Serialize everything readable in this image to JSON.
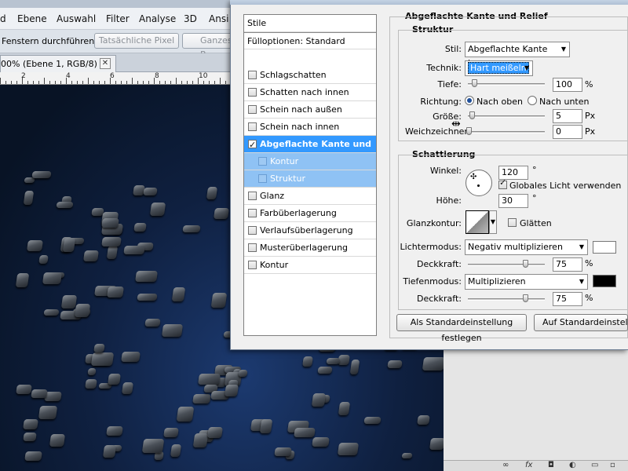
{
  "photoshop": {
    "menu": [
      "d",
      "Ebene",
      "Auswahl",
      "Filter",
      "Analyse",
      "3D",
      "Ansi"
    ],
    "options": {
      "run_in_windows_label": "Fenstern durchführen",
      "actual_pixels_label": "Tatsächliche Pixel",
      "whole_image_label": "Ganzes B"
    },
    "doc_tab": {
      "label": "00% (Ebene 1, RGB/8) *",
      "close": "✕"
    },
    "ruler_labels": [
      "2",
      "4",
      "6",
      "8",
      "10"
    ],
    "layers_bar_icons": [
      "∞",
      "fx",
      "◘",
      "◐",
      "▭",
      "▫"
    ]
  },
  "dialog": {
    "styles_list": {
      "header": "Stile",
      "fill_options": "Fülloptionen: Standard",
      "items": [
        {
          "label": "Schlagschatten",
          "checked": false
        },
        {
          "label": "Schatten nach innen",
          "checked": false
        },
        {
          "label": "Schein nach außen",
          "checked": false
        },
        {
          "label": "Schein nach innen",
          "checked": false
        },
        {
          "label": "Abgeflachte Kante und Relief",
          "checked": true
        },
        {
          "label": "Kontur",
          "checked": false
        },
        {
          "label": "Struktur",
          "checked": false
        },
        {
          "label": "Glanz",
          "checked": false
        },
        {
          "label": "Farbüberlagerung",
          "checked": false
        },
        {
          "label": "Verlaufsüberlagerung",
          "checked": false
        },
        {
          "label": "Musterüberlagerung",
          "checked": false
        },
        {
          "label": "Kontur",
          "checked": false
        }
      ]
    },
    "bevel": {
      "section_title": "Abgeflachte Kante und Relief",
      "structure_title": "Struktur",
      "style_label": "Stil:",
      "style_value": "Abgeflachte Kante innen",
      "technique_label": "Technik:",
      "technique_value": "Hart meißeln",
      "depth_label": "Tiefe:",
      "depth_value": "100",
      "depth_unit": "%",
      "direction_label": "Richtung:",
      "direction_up": "Nach oben",
      "direction_down": "Nach unten",
      "size_label": "Größe:",
      "size_value": "5",
      "size_unit": "Px",
      "soften_label": "Weichzeichnen:",
      "soften_value": "0",
      "soften_unit": "Px"
    },
    "shading": {
      "title": "Schattierung",
      "angle_label": "Winkel:",
      "angle_value": "120",
      "angle_unit": "°",
      "global_light_label": "Globales Licht verwenden",
      "altitude_label": "Höhe:",
      "altitude_value": "30",
      "altitude_unit": "°",
      "gloss_contour_label": "Glanzkontur:",
      "antialias_label": "Glätten",
      "highlight_mode_label": "Lichtermodus:",
      "highlight_mode_value": "Negativ multiplizieren",
      "highlight_color": "#ffffff",
      "highlight_opacity_label": "Deckkraft:",
      "highlight_opacity_value": "75",
      "highlight_opacity_unit": "%",
      "shadow_mode_label": "Tiefenmodus:",
      "shadow_mode_value": "Multiplizieren",
      "shadow_color": "#000000",
      "shadow_opacity_label": "Deckkraft:",
      "shadow_opacity_value": "75",
      "shadow_opacity_unit": "%"
    },
    "buttons": {
      "make_default": "Als Standardeinstellung festlegen",
      "reset_default": "Auf Standardeinstellung"
    }
  }
}
